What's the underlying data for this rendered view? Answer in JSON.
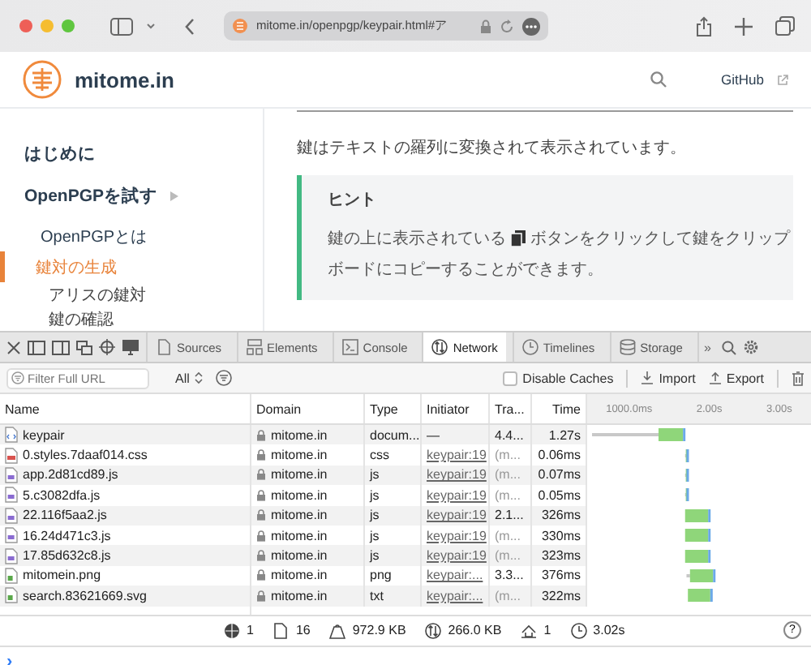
{
  "browser": {
    "url": "mitome.in/openpgp/keypair.html#ア"
  },
  "site": {
    "title": "mitome.in",
    "github": "GitHub"
  },
  "sidebar": {
    "items": [
      {
        "label": "はじめに",
        "selected": false
      },
      {
        "label": "OpenPGPを試す",
        "selected": false,
        "expanded": true,
        "children": [
          {
            "label": "OpenPGPとは",
            "selected": false
          },
          {
            "label": "鍵対の生成",
            "selected": true,
            "children": [
              {
                "label": "アリスの鍵対",
                "selected": false
              },
              {
                "label": "鍵の確認",
                "selected": false
              }
            ]
          }
        ]
      }
    ]
  },
  "content": {
    "paragraph": "鍵はテキストの羅列に変換されて表示されています。",
    "hint": {
      "title": "ヒント",
      "text_before": "鍵の上に表示されている",
      "text_after": "ボタンをクリックして鍵をクリップ",
      "text_end": "ボードにコピーすることができます。"
    }
  },
  "devtools": {
    "tabs": [
      {
        "label": "Sources",
        "selected": false
      },
      {
        "label": "Elements",
        "selected": false
      },
      {
        "label": "Console",
        "selected": false
      },
      {
        "label": "Network",
        "selected": true
      },
      {
        "label": "Timelines",
        "selected": false
      },
      {
        "label": "Storage",
        "selected": false
      }
    ],
    "more": "»",
    "filter": {
      "placeholder": "Filter Full URL",
      "type_filter": "All",
      "disable_caches": {
        "label": "Disable Caches",
        "checked": false
      },
      "import": "Import",
      "export": "Export"
    },
    "table": {
      "columns": [
        "Name",
        "Domain",
        "Type",
        "Initiator",
        "Tra...",
        "Time"
      ],
      "rows": [
        {
          "kind": "document",
          "name": "keypair",
          "domain": "mitome.in",
          "type": "docum...",
          "initiator": "—",
          "initiator_link": false,
          "transferred": "4.4...",
          "time": "1.27s"
        },
        {
          "kind": "css",
          "name": "0.styles.7daaf014.css",
          "domain": "mitome.in",
          "type": "css",
          "initiator": "keypair:19",
          "initiator_link": true,
          "transferred": "(m...",
          "time": "0.06ms"
        },
        {
          "kind": "js",
          "name": "app.2d81cd89.js",
          "domain": "mitome.in",
          "type": "js",
          "initiator": "keypair:19",
          "initiator_link": true,
          "transferred": "(m...",
          "time": "0.07ms"
        },
        {
          "kind": "js",
          "name": "5.c3082dfa.js",
          "domain": "mitome.in",
          "type": "js",
          "initiator": "keypair:19",
          "initiator_link": true,
          "transferred": "(m...",
          "time": "0.05ms"
        },
        {
          "kind": "js",
          "name": "22.116f5aa2.js",
          "domain": "mitome.in",
          "type": "js",
          "initiator": "keypair:19",
          "initiator_link": true,
          "transferred": "2.1...",
          "time": "326ms"
        },
        {
          "kind": "js",
          "name": "16.24d471c3.js",
          "domain": "mitome.in",
          "type": "js",
          "initiator": "keypair:19",
          "initiator_link": true,
          "transferred": "(m...",
          "time": "330ms"
        },
        {
          "kind": "js",
          "name": "17.85d632c8.js",
          "domain": "mitome.in",
          "type": "js",
          "initiator": "keypair:19",
          "initiator_link": true,
          "transferred": "(m...",
          "time": "323ms"
        },
        {
          "kind": "image",
          "name": "mitomein.png",
          "domain": "mitome.in",
          "type": "png",
          "initiator": "keypair:...",
          "initiator_link": true,
          "transferred": "3.3...",
          "time": "376ms"
        },
        {
          "kind": "image",
          "name": "search.83621669.svg",
          "domain": "mitome.in",
          "type": "txt",
          "initiator": "keypair:...",
          "initiator_link": true,
          "transferred": "(m...",
          "time": "322ms"
        }
      ],
      "timeline_ticks": [
        "1000.0ms",
        "2.00s",
        "3.00s"
      ]
    },
    "summary": [
      "1",
      "16",
      "972.9 KB",
      "266.0 KB",
      "1",
      "3.02s"
    ],
    "help": "?",
    "console": {
      "prompt": "›"
    }
  }
}
